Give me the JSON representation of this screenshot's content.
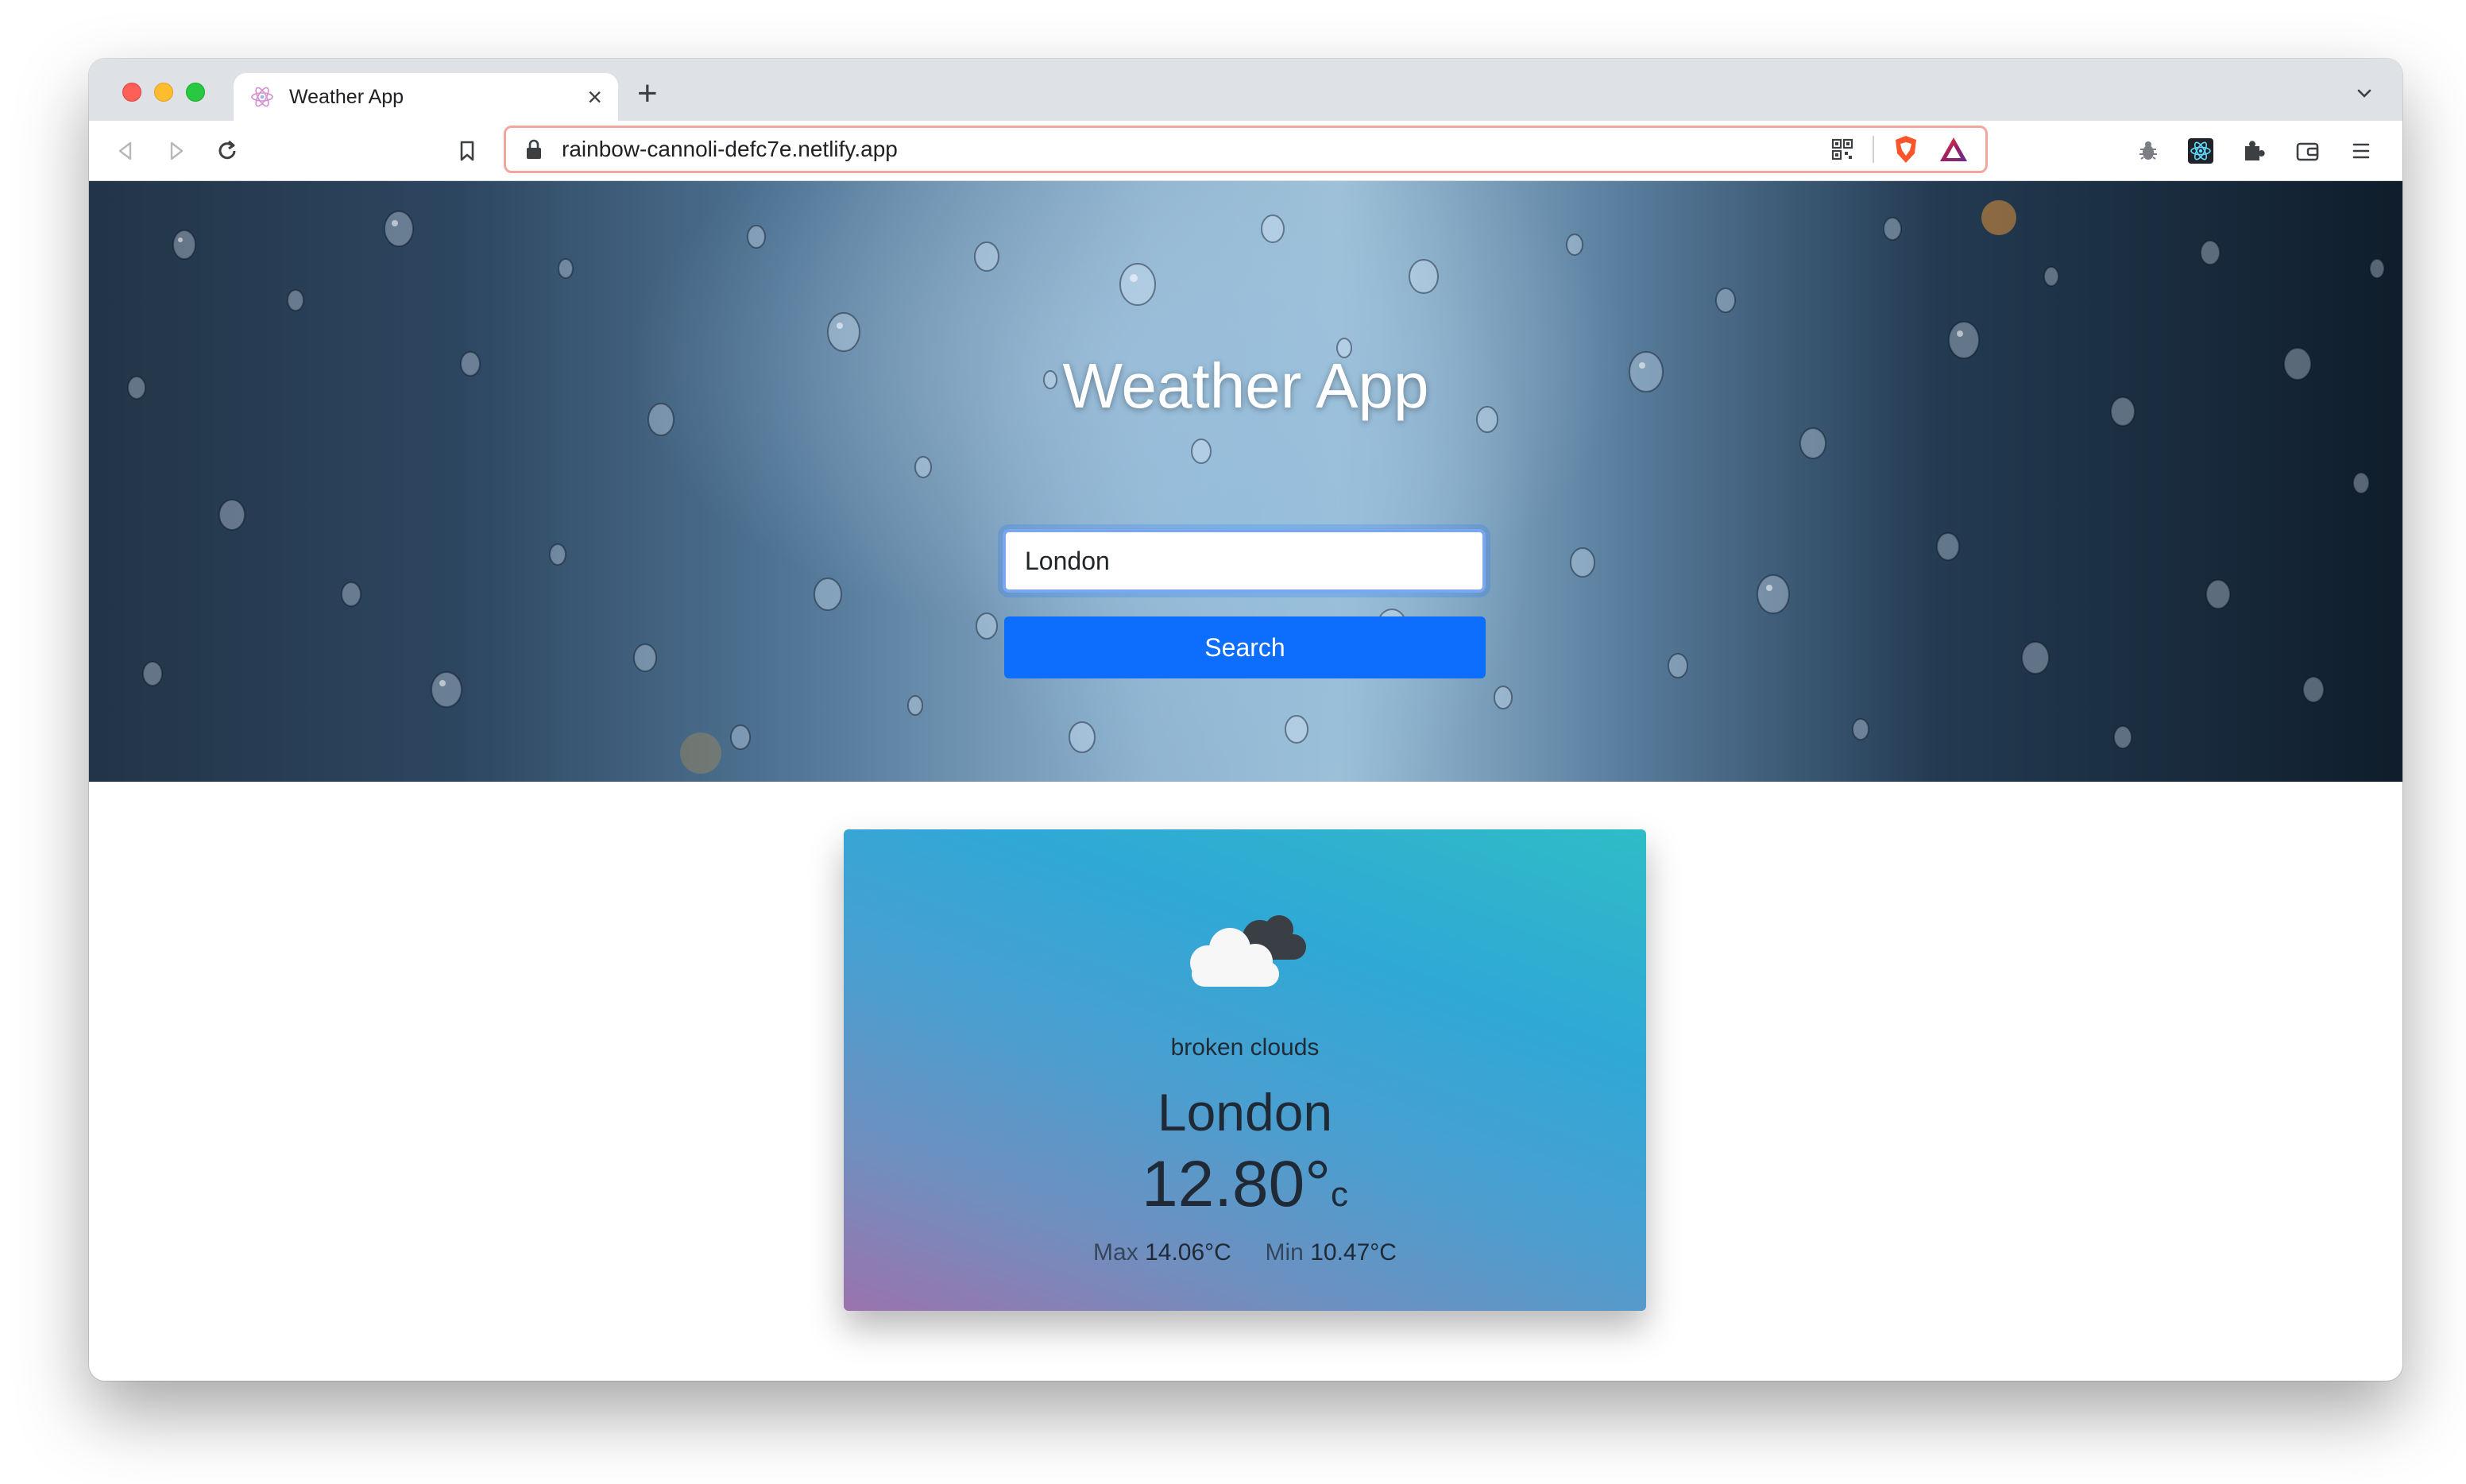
{
  "browser": {
    "tab_title": "Weather App",
    "url": "rainbow-cannoli-defc7e.netlify.app",
    "icons": [
      "back-icon",
      "forward-icon",
      "reload-icon",
      "bookmark-icon",
      "lock-icon",
      "qr-code-icon",
      "brave-shield-icon",
      "brave-rewards-icon",
      "bug-extension-icon",
      "react-devtools-icon",
      "extensions-puzzle-icon",
      "wallet-icon",
      "menu-icon"
    ]
  },
  "hero": {
    "title": "Weather App",
    "input_value": "London",
    "search_label": "Search"
  },
  "weather": {
    "description": "broken clouds",
    "city": "London",
    "temperature": "12.80°",
    "unit": "c",
    "max_label": "Max",
    "max_value": "14.06°C",
    "min_label": "Min",
    "min_value": "10.47°C"
  },
  "colors": {
    "primary_button": "#0d6efd",
    "omnibox_border": "#f2a69c"
  }
}
